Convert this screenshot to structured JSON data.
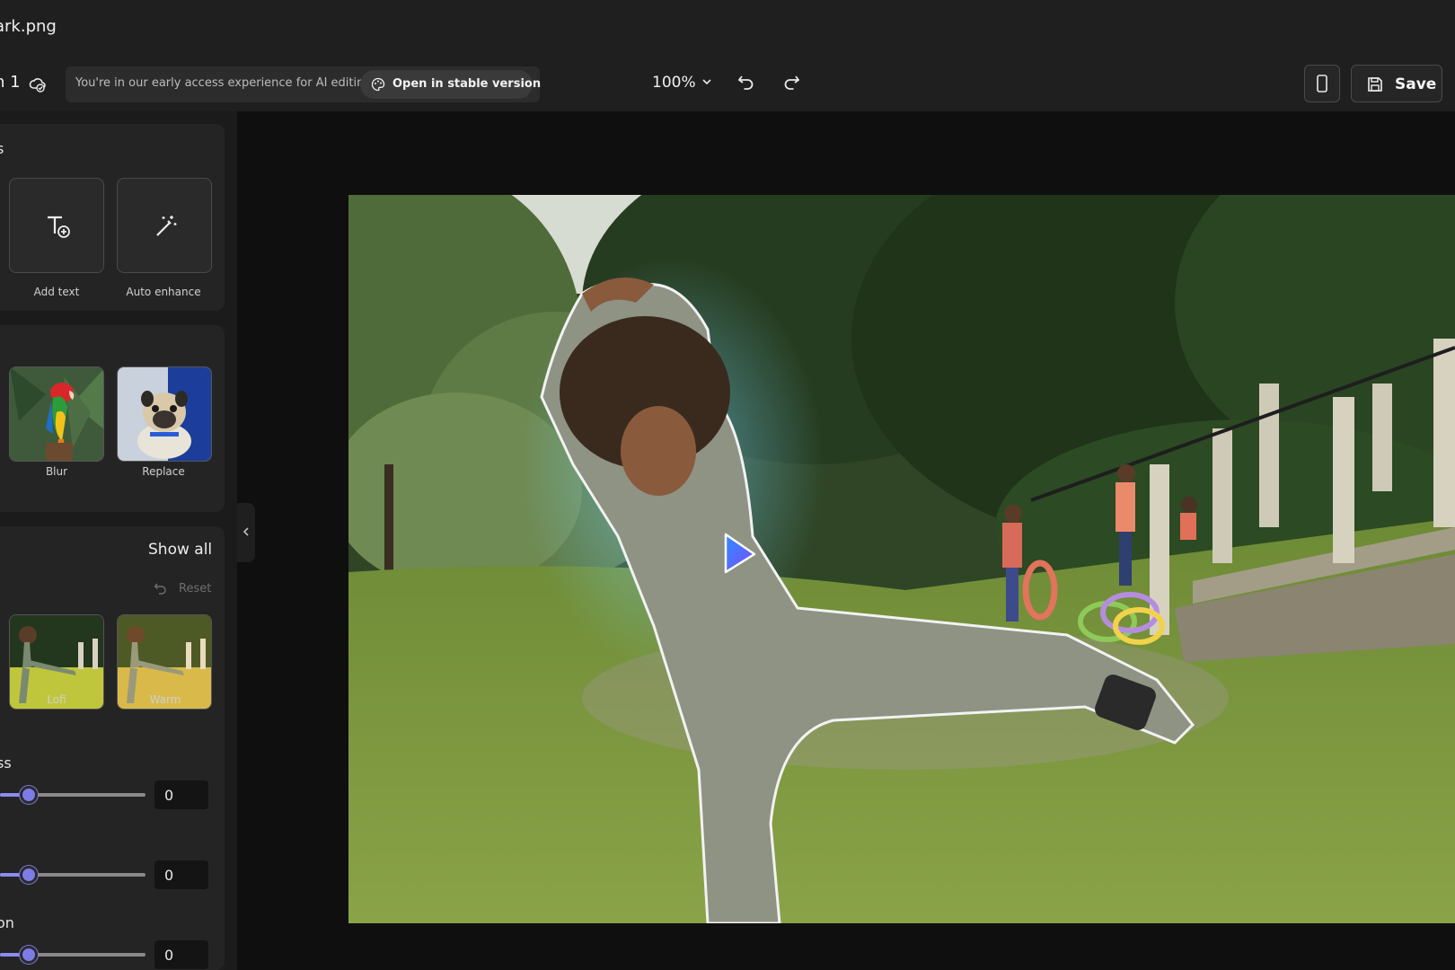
{
  "titlebar": {
    "file_name": "ark.png"
  },
  "toolbar": {
    "doc_name": "n 1",
    "early_access_text": "You're in our early access experience for AI editing",
    "open_stable_label": "Open in stable version",
    "zoom_level": "100%",
    "save_label": "Save"
  },
  "left_panel": {
    "quick_actions": {
      "section_fragment": "s",
      "tools": [
        {
          "label": "Add text",
          "icon": "add-text-icon"
        },
        {
          "label": "Auto enhance",
          "icon": "magic-wand-icon"
        }
      ]
    },
    "background": {
      "options": [
        {
          "label": "Blur",
          "thumb": "parrot-thumbnail"
        },
        {
          "label": "Replace",
          "thumb": "pug-thumbnail"
        }
      ]
    },
    "filters": {
      "show_all_label": "Show all",
      "reset_label": "Reset",
      "presets": [
        {
          "label": "Lofi"
        },
        {
          "label": "Warm"
        }
      ]
    },
    "adjustments": [
      {
        "label_fragment": "ss",
        "value": "0",
        "level": 0.2
      },
      {
        "label_fragment": "",
        "value": "0",
        "level": 0.2
      },
      {
        "label_fragment": "on",
        "value": "0",
        "level": 0.2
      }
    ]
  },
  "colors": {
    "accent": "#7f7be6",
    "panel_bg": "#1b1b1b",
    "card_bg": "#242424",
    "toolbar_bg": "#1f1f1f"
  }
}
